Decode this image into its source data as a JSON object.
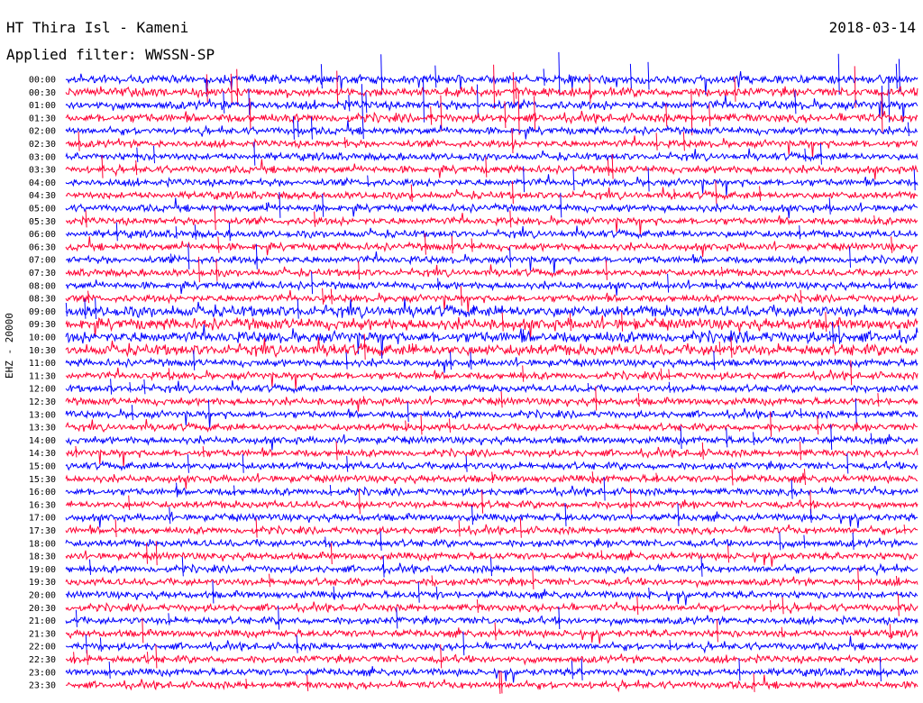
{
  "header": {
    "station": "HT Thira Isl - Kameni",
    "filter": "Applied filter: WWSSN-SP",
    "date": "2018-03-14"
  },
  "chart_data": {
    "type": "line",
    "ylabel": "EHZ - 20000",
    "rows": [
      "00:00",
      "00:30",
      "01:00",
      "01:30",
      "02:00",
      "02:30",
      "03:00",
      "03:30",
      "04:00",
      "04:30",
      "05:00",
      "05:30",
      "06:00",
      "06:30",
      "07:00",
      "07:30",
      "08:00",
      "08:30",
      "09:00",
      "09:30",
      "10:00",
      "10:30",
      "11:00",
      "11:30",
      "12:00",
      "12:30",
      "13:00",
      "13:30",
      "14:00",
      "14:30",
      "15:00",
      "15:30",
      "16:00",
      "16:30",
      "17:00",
      "17:30",
      "18:00",
      "18:30",
      "19:00",
      "19:30",
      "20:00",
      "20:30",
      "21:00",
      "21:30",
      "22:00",
      "22:30",
      "23:00",
      "23:30"
    ],
    "colors": [
      "#0000ff",
      "#ff0033"
    ]
  }
}
